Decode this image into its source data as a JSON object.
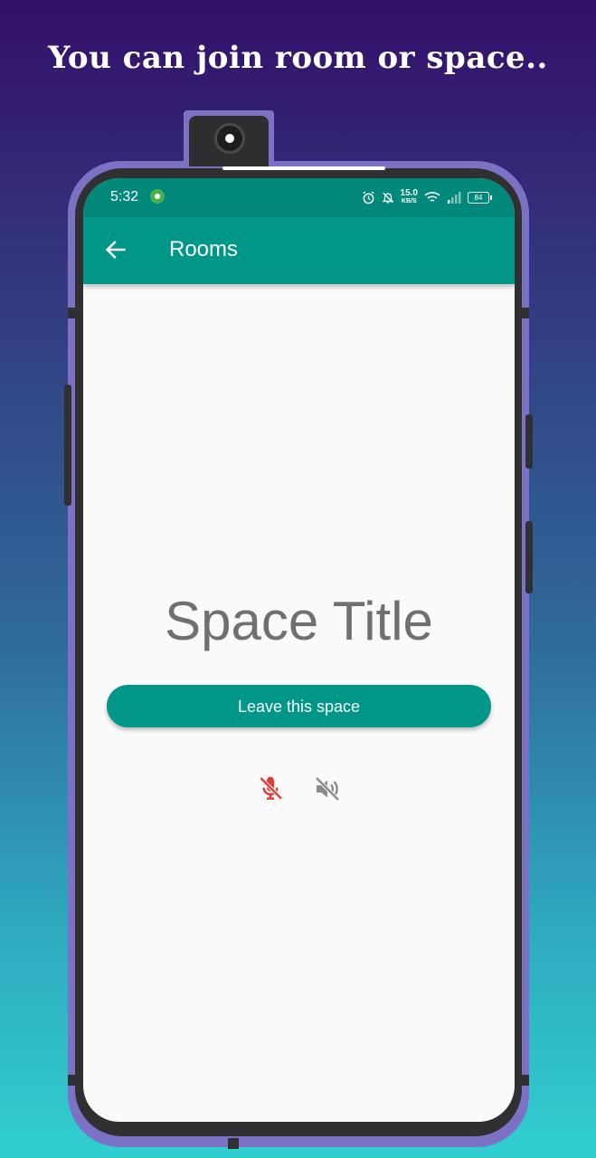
{
  "headline": "You can join room or space..",
  "status_bar": {
    "time": "5:32",
    "speed_value": "15.0",
    "speed_unit": "KB/S",
    "battery": "84",
    "icons": [
      "whatsapp-icon",
      "alarm-icon",
      "mute-bell-icon",
      "wifi-icon",
      "signal-icon",
      "battery-icon"
    ]
  },
  "app_bar": {
    "title": "Rooms",
    "back_icon": "arrow-back-icon"
  },
  "main": {
    "space_title": "Space Title",
    "leave_button": "Leave this space",
    "controls": [
      {
        "name": "mic-off-icon",
        "color": "#e53935"
      },
      {
        "name": "speaker-off-icon",
        "color": "#8a8a8a"
      }
    ]
  },
  "colors": {
    "primary": "#009688",
    "status_bar": "#00897b",
    "phone_frame": "#7b72c6"
  }
}
